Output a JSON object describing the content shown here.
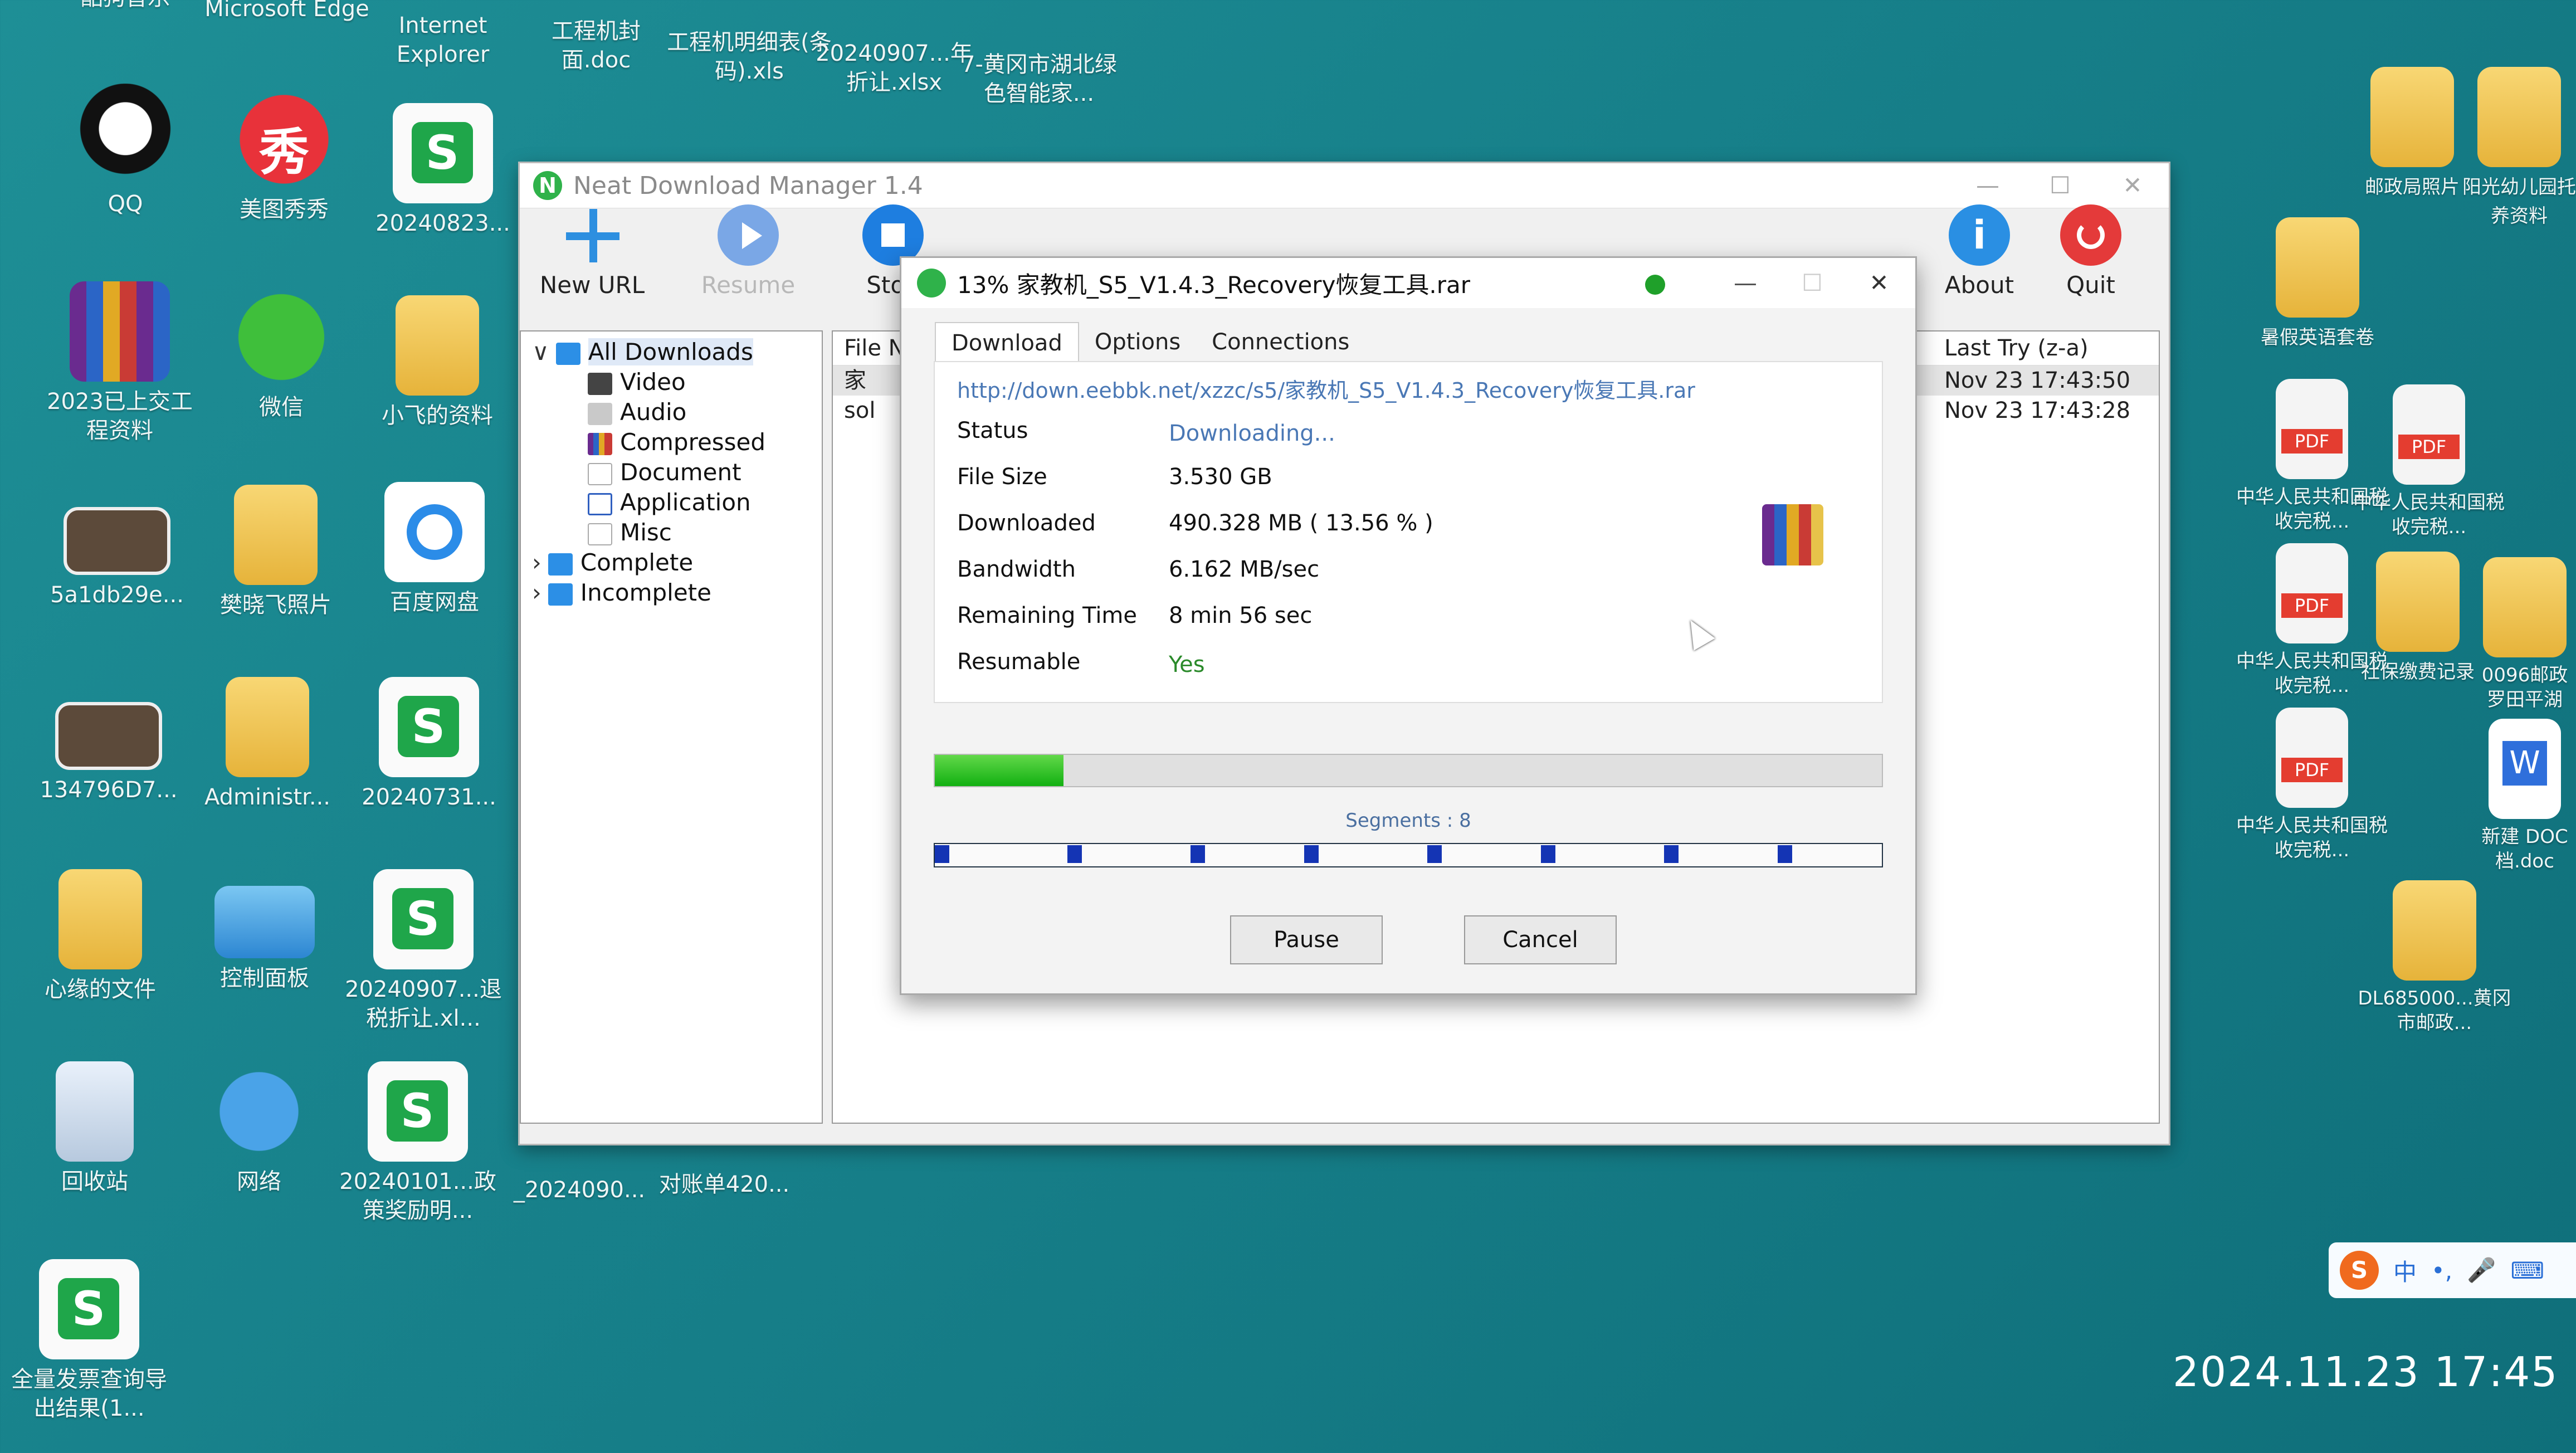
{
  "desktop": {
    "icons_left": [
      {
        "label": "酷狗音乐"
      },
      {
        "label": "Microsoft Edge"
      },
      {
        "label": "Internet Explorer"
      },
      {
        "label": "工程机封面.doc"
      },
      {
        "label": "工程机明细表(条码).xls"
      },
      {
        "label": "20240907...年折让.xlsx"
      },
      {
        "label": "7-黄冈市湖北绿色智能家..."
      },
      {
        "label": "QQ"
      },
      {
        "label": "美图秀秀"
      },
      {
        "label": "20240823..."
      },
      {
        "label": "2023已上交工程资料"
      },
      {
        "label": "微信"
      },
      {
        "label": "小飞的资料"
      },
      {
        "label": "5a1db29e..."
      },
      {
        "label": "樊晓飞照片"
      },
      {
        "label": "百度网盘"
      },
      {
        "label": "134796D7..."
      },
      {
        "label": "Administr..."
      },
      {
        "label": "20240731..."
      },
      {
        "label": "心缘的文件"
      },
      {
        "label": "控制面板"
      },
      {
        "label": "20240907...退税折让.xl..."
      },
      {
        "label": "回收站"
      },
      {
        "label": "网络"
      },
      {
        "label": "20240101...政策奖励明..."
      },
      {
        "label": "_2024090..."
      },
      {
        "label": "对账单420..."
      },
      {
        "label": "全量发票查询导出结果(1..."
      }
    ],
    "icons_right": [
      {
        "label": "邮政局照片"
      },
      {
        "label": "阳光幼儿园托养资料"
      },
      {
        "label": "暑假英语套卷"
      },
      {
        "label": "中华人民共和国税收完税..."
      },
      {
        "label": "中华人民共和国税收完税..."
      },
      {
        "label": "中华人民共和国税收完税..."
      },
      {
        "label": "社保缴费记录"
      },
      {
        "label": "0096邮政罗田平湖"
      },
      {
        "label": "中华人民共和国税收完税..."
      },
      {
        "label": "新建 DOC 档.doc"
      },
      {
        "label": "DL685000...黄冈市邮政..."
      }
    ],
    "ime": {
      "label": "中"
    },
    "clock": "2024.11.23   17:45"
  },
  "ndm": {
    "title": "Neat Download Manager 1.4",
    "toolbar": {
      "new_url": "New URL",
      "resume": "Resume",
      "stop": "Stop",
      "about": "About",
      "quit": "Quit"
    },
    "tree": {
      "all": "All Downloads",
      "video": "Video",
      "audio": "Audio",
      "compressed": "Compressed",
      "document": "Document",
      "application": "Application",
      "misc": "Misc",
      "complete": "Complete",
      "incomplete": "Incomplete"
    },
    "list": {
      "col_file": "File Na",
      "col_last_try": "Last Try (z-a)",
      "rows": [
        {
          "file": "家",
          "last_try": "Nov 23  17:43:50"
        },
        {
          "file": "sol",
          "last_try": "Nov 23  17:43:28"
        }
      ]
    }
  },
  "dialog": {
    "title": "13%  家教机_S5_V1.4.3_Recovery恢复工具.rar",
    "tabs": [
      "Download",
      "Options",
      "Connections"
    ],
    "url": "http://down.eebbk.net/xzzc/s5/家教机_S5_V1.4.3_Recovery恢复工具.rar",
    "fields": {
      "status_label": "Status",
      "status_value": "Downloading...",
      "size_label": "File Size",
      "size_value": "3.530 GB",
      "downloaded_label": "Downloaded",
      "downloaded_value": "490.328 MB ( 13.56 % )",
      "bandwidth_label": "Bandwidth",
      "bandwidth_value": "6.162 MB/sec",
      "remaining_label": "Remaining Time",
      "remaining_value": "8 min  56 sec",
      "resumable_label": "Resumable",
      "resumable_value": "Yes"
    },
    "progress_percent": 13.56,
    "segments_label": "Segments : 8",
    "segment_positions": [
      0.0,
      0.14,
      0.27,
      0.39,
      0.52,
      0.64,
      0.77,
      0.89
    ],
    "pause": "Pause",
    "cancel": "Cancel"
  }
}
